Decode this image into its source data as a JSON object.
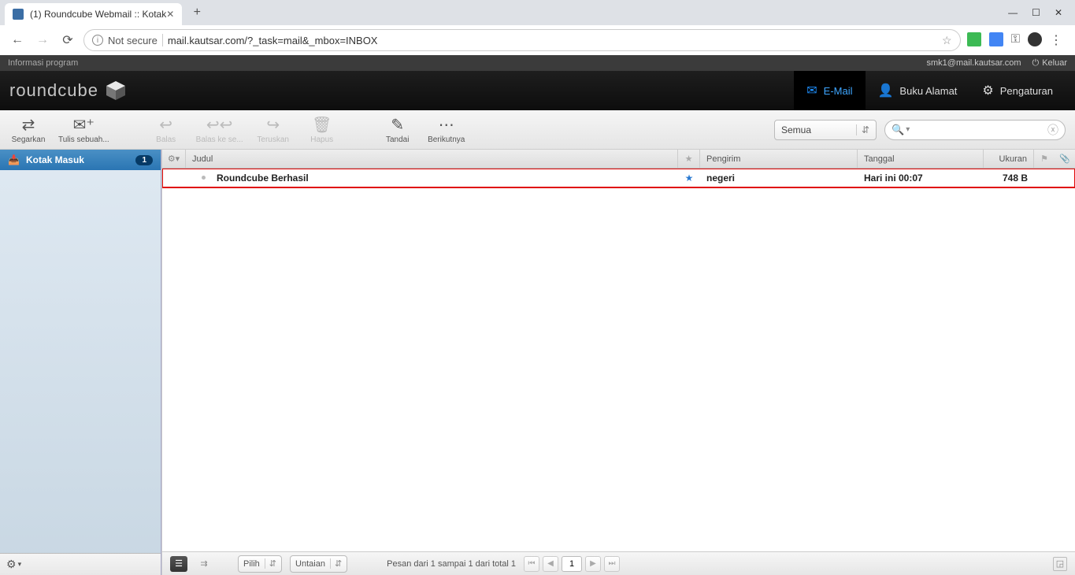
{
  "browser": {
    "tab_title": "(1) Roundcube Webmail :: Kotak",
    "not_secure": "Not secure",
    "url": "mail.kautsar.com/?_task=mail&_mbox=INBOX"
  },
  "topbar": {
    "info": "Informasi program",
    "user": "smk1@mail.kautsar.com",
    "logout": "Keluar"
  },
  "logo": "roundcube",
  "nav": {
    "email": "E-Mail",
    "contacts": "Buku Alamat",
    "settings": "Pengaturan"
  },
  "toolbar": {
    "refresh": "Segarkan",
    "compose": "Tulis sebuah...",
    "reply": "Balas",
    "replyall": "Balas ke se...",
    "forward": "Teruskan",
    "delete": "Hapus",
    "mark": "Tandai",
    "more": "Berikutnya",
    "filter": "Semua"
  },
  "sidebar": {
    "inbox": "Kotak Masuk",
    "inbox_count": "1"
  },
  "headers": {
    "subject": "Judul",
    "sender": "Pengirim",
    "date": "Tanggal",
    "size": "Ukuran"
  },
  "messages": [
    {
      "subject": "Roundcube Berhasil",
      "sender": "negeri",
      "date": "Hari ini 00:07",
      "size": "748 B"
    }
  ],
  "footer": {
    "select": "Pilih",
    "threads": "Untaian",
    "status": "Pesan dari 1 sampai 1 dari total 1",
    "page": "1"
  }
}
